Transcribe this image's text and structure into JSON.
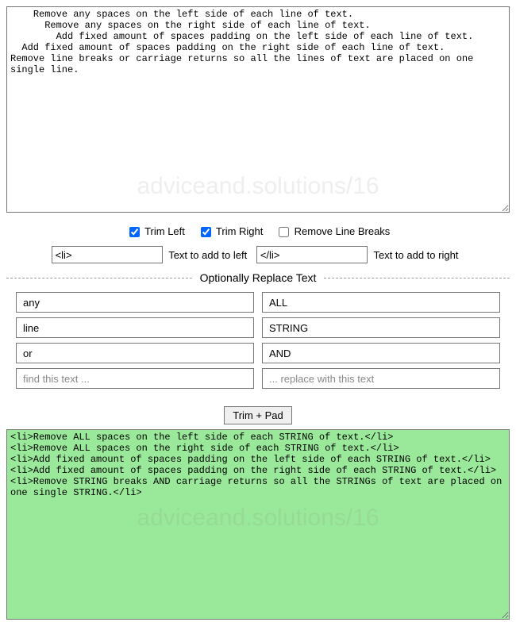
{
  "watermark": "adviceand.solutions/16",
  "input_text": "    Remove any spaces on the left side of each line of text.\n      Remove any spaces on the right side of each line of text.\n        Add fixed amount of spaces padding on the left side of each line of text.\n  Add fixed amount of spaces padding on the right side of each line of text.\nRemove line breaks or carriage returns so all the lines of text are placed on one single line.",
  "options": {
    "trim_left": {
      "label": "Trim Left",
      "checked": true
    },
    "trim_right": {
      "label": "Trim Right",
      "checked": true
    },
    "remove_breaks": {
      "label": "Remove Line Breaks",
      "checked": false
    }
  },
  "pad": {
    "left_value": "<li>",
    "left_label": "Text to add to left",
    "right_value": "</li>",
    "right_label": "Text to add to right"
  },
  "replace_heading": "Optionally Replace Text",
  "replace_rows": [
    {
      "find": "any",
      "replace": "ALL"
    },
    {
      "find": "line",
      "replace": "STRING"
    },
    {
      "find": "or",
      "replace": "AND"
    },
    {
      "find": "",
      "replace": ""
    }
  ],
  "replace_placeholders": {
    "find": "find this text ...",
    "replace": "... replace with this text"
  },
  "button_label": "Trim + Pad",
  "output_text": "<li>Remove ALL spaces on the left side of each STRING of text.</li>\n<li>Remove ALL spaces on the right side of each STRING of text.</li>\n<li>Add fixed amount of spaces padding on the left side of each STRING of text.</li>\n<li>Add fixed amount of spaces padding on the right side of each STRING of text.</li>\n<li>Remove STRING breaks AND carriage returns so all the STRINGs of text are placed on one single STRING.</li>"
}
